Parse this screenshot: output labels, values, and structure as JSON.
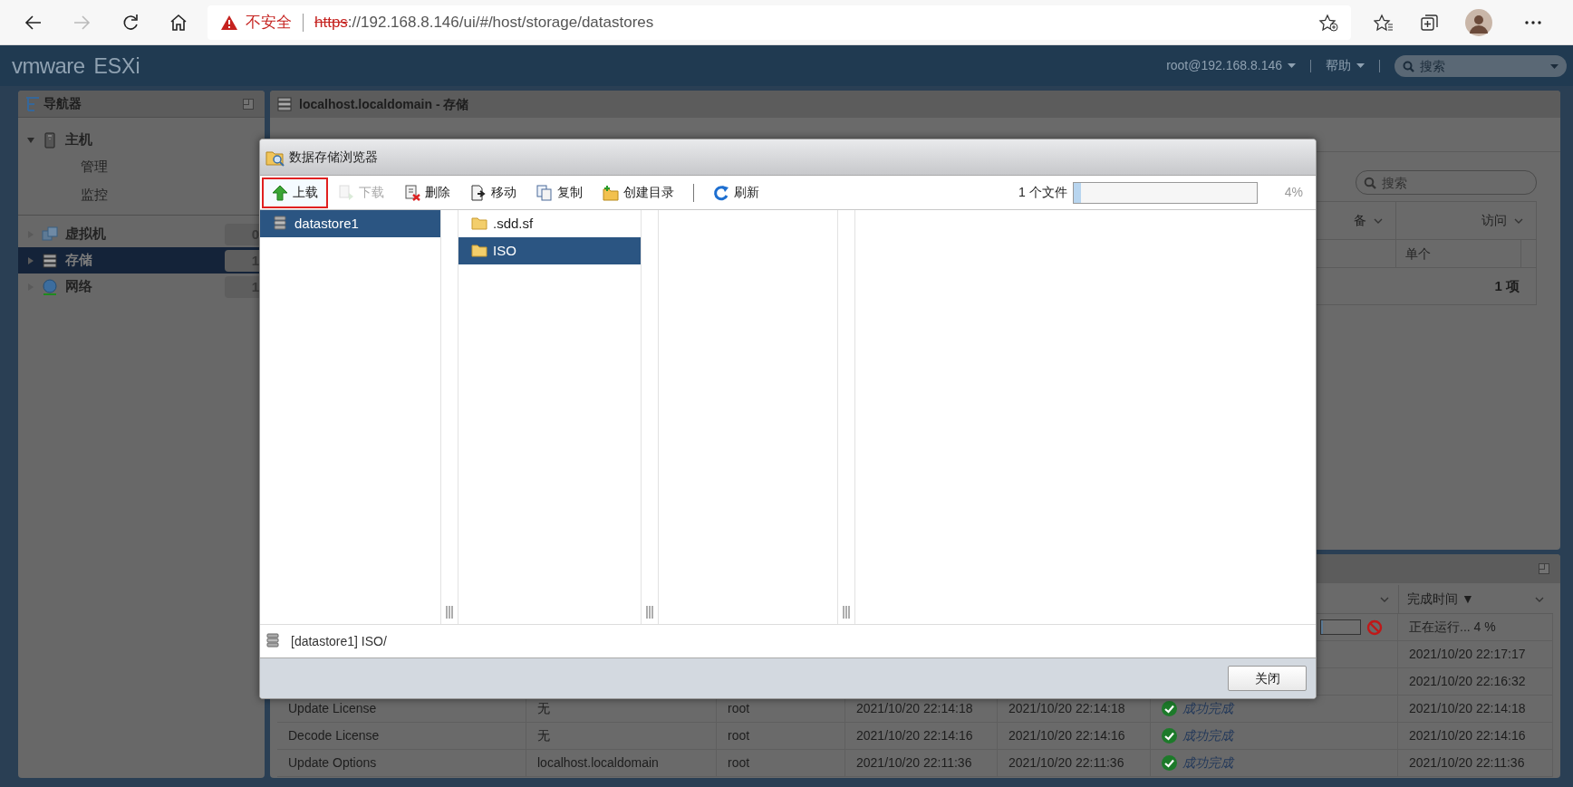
{
  "browser": {
    "security_warning": "不安全",
    "url_scheme": "https",
    "url_rest": "://192.168.8.146/ui/#/host/storage/datastores"
  },
  "header": {
    "logo_brand": "vmware",
    "logo_product": "ESXi",
    "user": "root@192.168.8.146",
    "help": "帮助",
    "search_placeholder": "搜索"
  },
  "navigator": {
    "title": "导航器",
    "items": [
      {
        "label": "主机",
        "expanded": true,
        "selected": false,
        "children": [
          {
            "label": "管理"
          },
          {
            "label": "监控"
          }
        ]
      },
      {
        "label": "虚拟机",
        "expanded": false,
        "selected": false,
        "count": "0"
      },
      {
        "label": "存储",
        "expanded": false,
        "selected": true,
        "count": "1"
      },
      {
        "label": "网络",
        "expanded": false,
        "selected": false,
        "count": "1"
      }
    ]
  },
  "storage_panel": {
    "title": "localhost.localdomain - 存储",
    "search_placeholder": "搜索",
    "columns": [
      "备",
      "访问"
    ],
    "rows": [
      [
        "单个"
      ]
    ],
    "footer": "1 项"
  },
  "tasks_panel": {
    "columns": [
      "完成时间 ▼"
    ],
    "rows": [
      {
        "kind": "running",
        "level": 0.04,
        "completed": "正在运行... 4 %"
      },
      {
        "kind": "hidden",
        "completed": "2021/10/20 22:17:17"
      },
      {
        "kind": "hidden",
        "completed": "2021/10/20 22:16:32"
      },
      {
        "kind": "success",
        "name": "Update License",
        "target": "无",
        "initiator": "root",
        "queued": "2021/10/20 22:14:18",
        "started": "2021/10/20 22:14:18",
        "result": "成功完成",
        "completed": "2021/10/20 22:14:18"
      },
      {
        "kind": "success",
        "name": "Decode License",
        "target": "无",
        "initiator": "root",
        "queued": "2021/10/20 22:14:16",
        "started": "2021/10/20 22:14:16",
        "result": "成功完成",
        "completed": "2021/10/20 22:14:16"
      },
      {
        "kind": "success",
        "name": "Update Options",
        "target": "localhost.localdomain",
        "initiator": "root",
        "queued": "2021/10/20 22:11:36",
        "started": "2021/10/20 22:11:36",
        "result": "成功完成",
        "completed": "2021/10/20 22:11:36"
      }
    ]
  },
  "dialog": {
    "title": "数据存储浏览器",
    "toolbar": [
      {
        "kind": "button",
        "label": "上载",
        "disabled": false,
        "highlighted": true
      },
      {
        "kind": "button",
        "label": "下载",
        "disabled": true,
        "highlighted": false
      },
      {
        "kind": "button",
        "label": "删除",
        "disabled": false,
        "highlighted": false
      },
      {
        "kind": "button",
        "label": "移动",
        "disabled": false,
        "highlighted": false
      },
      {
        "kind": "button",
        "label": "复制",
        "disabled": false,
        "highlighted": false
      },
      {
        "kind": "button",
        "label": "创建目录",
        "disabled": false,
        "highlighted": false
      },
      {
        "kind": "separator"
      },
      {
        "kind": "button",
        "label": "刷新",
        "disabled": false,
        "highlighted": false
      }
    ],
    "upload_status": {
      "files": "1 个文件",
      "level": 0.04,
      "percent": "4%"
    },
    "columns": [
      [
        {
          "label": "datastore1",
          "selected": true
        }
      ],
      [
        {
          "label": ".sdd.sf",
          "selected": false
        },
        {
          "label": "ISO",
          "selected": true
        }
      ]
    ],
    "path": "[datastore1] ISO/",
    "close_button": "关闭"
  }
}
